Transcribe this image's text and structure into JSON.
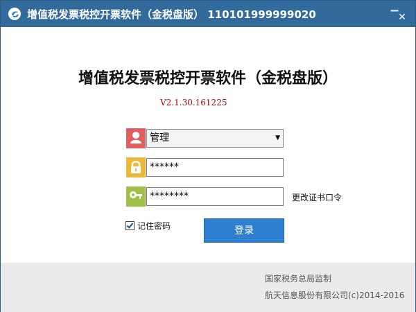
{
  "window": {
    "title": "增值税发票税控开票软件（金税盘版） 110101999999020",
    "minimize_glyph": "▁",
    "close_glyph": "✕"
  },
  "main": {
    "heading": "增值税发票税控开票软件（金税盘版）",
    "version": "V2.1.30.161225"
  },
  "form": {
    "user": {
      "icon": "user-icon",
      "value": "管理",
      "arrow": "▼",
      "accent": "#e06060"
    },
    "password": {
      "icon": "lock-icon",
      "value": "******",
      "accent": "#e9b93a"
    },
    "cert_password": {
      "icon": "key-icon",
      "value": "********",
      "accent": "#9ec04a"
    },
    "change_cert_label": "更改证书口令",
    "remember_label": "记住密码",
    "login_label": "登录"
  },
  "footer": {
    "line1": "国家税务总局监制",
    "line2": "航天信息股份有限公司(c)2014-2016"
  },
  "colors": {
    "titlebar": "#326a9c",
    "login": "#2f7fd0",
    "version": "#b30000"
  }
}
